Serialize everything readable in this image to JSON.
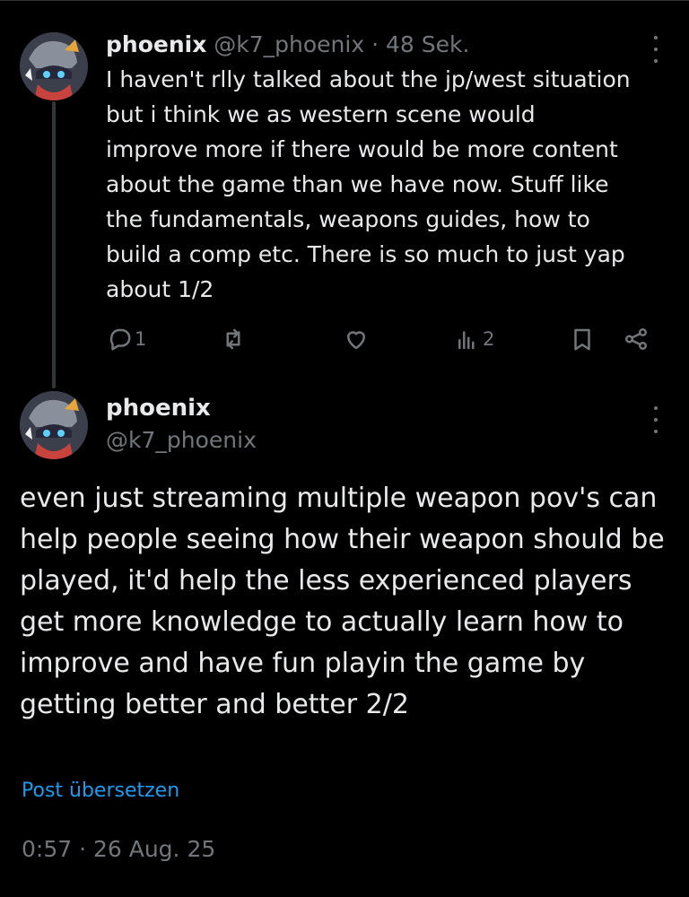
{
  "reply_tweet": {
    "display_name": "phoenix",
    "handle": "@k7_phoenix",
    "separator": "·",
    "time": "48 Sek.",
    "text": "I haven't rlly talked about the jp/west situation\nbut i think we as western scene would\nimprove more if there would be more content\nabout the game than we have now. Stuff like\nthe fundamentals, weapons guides, how to\nbuild a comp etc. There is so much to just yap\nabout 1/2",
    "actions": {
      "reply_count": "1",
      "retweet_count": "",
      "like_count": "",
      "views_count": "2"
    }
  },
  "main_tweet": {
    "display_name": "phoenix",
    "handle": "@k7_phoenix",
    "text": "even just streaming multiple weapon pov's can help people seeing how their weapon should be played, it'd help the less experienced players get more knowledge to actually learn how to improve and have fun playin the game by getting better and better 2/2",
    "translate_label": "Post übersetzen",
    "timestamp": "0:57 · 26 Aug. 25"
  },
  "colors": {
    "background": "#000000",
    "text": "#e7e9ea",
    "muted": "#71767b",
    "link": "#1d9bf0",
    "thread_line": "#333639"
  },
  "icons": [
    "more-icon",
    "reply-icon",
    "retweet-icon",
    "like-icon",
    "views-icon",
    "bookmark-icon",
    "share-icon"
  ]
}
